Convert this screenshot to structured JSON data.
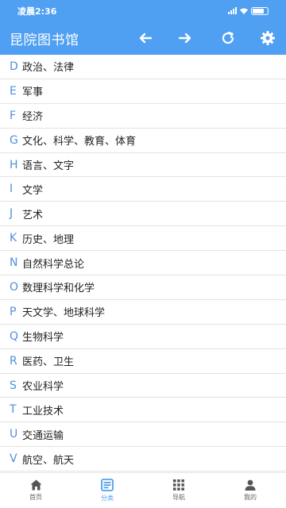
{
  "status": {
    "time": "凌晨2:36"
  },
  "app": {
    "title": "昆院图书馆"
  },
  "categories": [
    {
      "code": "D",
      "label": "政治、法律"
    },
    {
      "code": "E",
      "label": "军事"
    },
    {
      "code": "F",
      "label": "经济"
    },
    {
      "code": "G",
      "label": "文化、科学、教育、体育"
    },
    {
      "code": "H",
      "label": "语言、文字"
    },
    {
      "code": "I",
      "label": "文学"
    },
    {
      "code": "J",
      "label": "艺术"
    },
    {
      "code": "K",
      "label": "历史、地理"
    },
    {
      "code": "N",
      "label": "自然科学总论"
    },
    {
      "code": "O",
      "label": "数理科学和化学"
    },
    {
      "code": "P",
      "label": "天文学、地球科学"
    },
    {
      "code": "Q",
      "label": "生物科学"
    },
    {
      "code": "R",
      "label": "医药、卫生"
    },
    {
      "code": "S",
      "label": "农业科学"
    },
    {
      "code": "T",
      "label": "工业技术"
    },
    {
      "code": "U",
      "label": "交通运输"
    },
    {
      "code": "V",
      "label": "航空、航天"
    }
  ],
  "tabs": [
    {
      "label": "首页",
      "icon": "home-icon"
    },
    {
      "label": "分类",
      "icon": "category-list-icon",
      "active": true
    },
    {
      "label": "导航",
      "icon": "grid-icon"
    },
    {
      "label": "我的",
      "icon": "user-icon"
    }
  ],
  "colors": {
    "accent": "#4f9ff2",
    "code": "#4f8fe0"
  }
}
